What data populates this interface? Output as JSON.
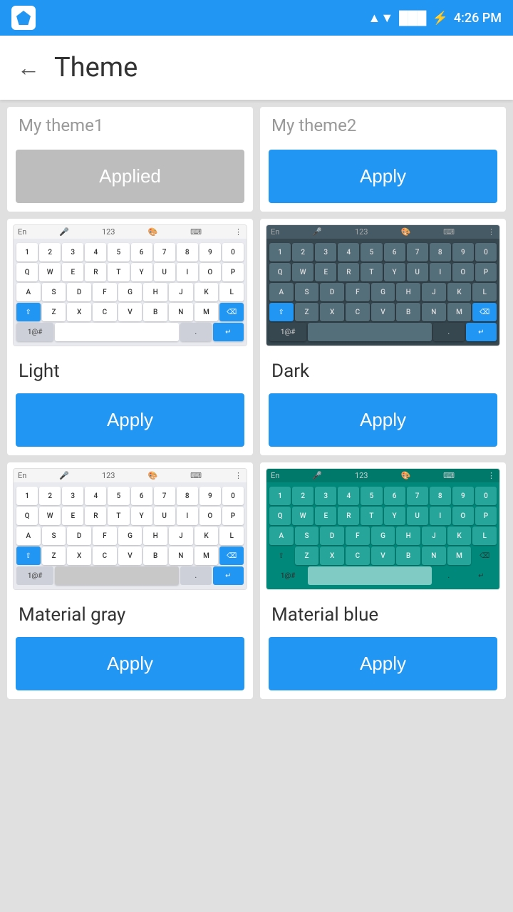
{
  "statusBar": {
    "time": "4:26 PM",
    "wifi": "WiFi",
    "signal": "Signal",
    "battery": "Battery"
  },
  "header": {
    "backLabel": "←",
    "title": "Theme"
  },
  "themes": [
    {
      "id": "my-theme-1",
      "name": "My theme1",
      "type": "my-theme",
      "buttonLabel": "Applied",
      "buttonType": "applied"
    },
    {
      "id": "my-theme-2",
      "name": "My theme2",
      "type": "my-theme",
      "buttonLabel": "Apply",
      "buttonType": "apply"
    },
    {
      "id": "light",
      "name": "Light",
      "type": "keyboard",
      "style": "light",
      "buttonLabel": "Apply",
      "buttonType": "apply"
    },
    {
      "id": "dark",
      "name": "Dark",
      "type": "keyboard",
      "style": "dark",
      "buttonLabel": "Apply",
      "buttonType": "apply"
    },
    {
      "id": "material-gray",
      "name": "Material gray",
      "type": "keyboard",
      "style": "gray",
      "buttonLabel": "Apply",
      "buttonType": "apply"
    },
    {
      "id": "material-blue",
      "name": "Material blue",
      "type": "keyboard",
      "style": "blue",
      "buttonLabel": "Apply",
      "buttonType": "apply"
    }
  ]
}
